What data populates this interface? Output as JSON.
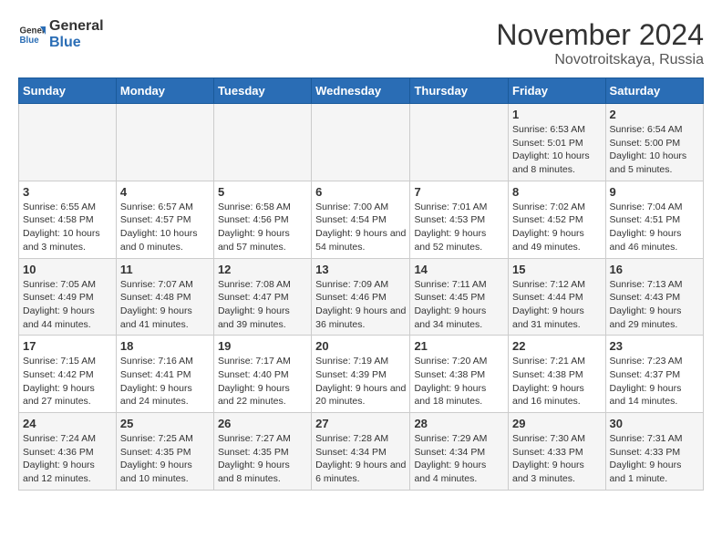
{
  "logo": {
    "text1": "General",
    "text2": "Blue"
  },
  "title": "November 2024",
  "subtitle": "Novotroitskaya, Russia",
  "weekdays": [
    "Sunday",
    "Monday",
    "Tuesday",
    "Wednesday",
    "Thursday",
    "Friday",
    "Saturday"
  ],
  "weeks": [
    [
      {
        "day": "",
        "info": ""
      },
      {
        "day": "",
        "info": ""
      },
      {
        "day": "",
        "info": ""
      },
      {
        "day": "",
        "info": ""
      },
      {
        "day": "",
        "info": ""
      },
      {
        "day": "1",
        "info": "Sunrise: 6:53 AM\nSunset: 5:01 PM\nDaylight: 10 hours and 8 minutes."
      },
      {
        "day": "2",
        "info": "Sunrise: 6:54 AM\nSunset: 5:00 PM\nDaylight: 10 hours and 5 minutes."
      }
    ],
    [
      {
        "day": "3",
        "info": "Sunrise: 6:55 AM\nSunset: 4:58 PM\nDaylight: 10 hours and 3 minutes."
      },
      {
        "day": "4",
        "info": "Sunrise: 6:57 AM\nSunset: 4:57 PM\nDaylight: 10 hours and 0 minutes."
      },
      {
        "day": "5",
        "info": "Sunrise: 6:58 AM\nSunset: 4:56 PM\nDaylight: 9 hours and 57 minutes."
      },
      {
        "day": "6",
        "info": "Sunrise: 7:00 AM\nSunset: 4:54 PM\nDaylight: 9 hours and 54 minutes."
      },
      {
        "day": "7",
        "info": "Sunrise: 7:01 AM\nSunset: 4:53 PM\nDaylight: 9 hours and 52 minutes."
      },
      {
        "day": "8",
        "info": "Sunrise: 7:02 AM\nSunset: 4:52 PM\nDaylight: 9 hours and 49 minutes."
      },
      {
        "day": "9",
        "info": "Sunrise: 7:04 AM\nSunset: 4:51 PM\nDaylight: 9 hours and 46 minutes."
      }
    ],
    [
      {
        "day": "10",
        "info": "Sunrise: 7:05 AM\nSunset: 4:49 PM\nDaylight: 9 hours and 44 minutes."
      },
      {
        "day": "11",
        "info": "Sunrise: 7:07 AM\nSunset: 4:48 PM\nDaylight: 9 hours and 41 minutes."
      },
      {
        "day": "12",
        "info": "Sunrise: 7:08 AM\nSunset: 4:47 PM\nDaylight: 9 hours and 39 minutes."
      },
      {
        "day": "13",
        "info": "Sunrise: 7:09 AM\nSunset: 4:46 PM\nDaylight: 9 hours and 36 minutes."
      },
      {
        "day": "14",
        "info": "Sunrise: 7:11 AM\nSunset: 4:45 PM\nDaylight: 9 hours and 34 minutes."
      },
      {
        "day": "15",
        "info": "Sunrise: 7:12 AM\nSunset: 4:44 PM\nDaylight: 9 hours and 31 minutes."
      },
      {
        "day": "16",
        "info": "Sunrise: 7:13 AM\nSunset: 4:43 PM\nDaylight: 9 hours and 29 minutes."
      }
    ],
    [
      {
        "day": "17",
        "info": "Sunrise: 7:15 AM\nSunset: 4:42 PM\nDaylight: 9 hours and 27 minutes."
      },
      {
        "day": "18",
        "info": "Sunrise: 7:16 AM\nSunset: 4:41 PM\nDaylight: 9 hours and 24 minutes."
      },
      {
        "day": "19",
        "info": "Sunrise: 7:17 AM\nSunset: 4:40 PM\nDaylight: 9 hours and 22 minutes."
      },
      {
        "day": "20",
        "info": "Sunrise: 7:19 AM\nSunset: 4:39 PM\nDaylight: 9 hours and 20 minutes."
      },
      {
        "day": "21",
        "info": "Sunrise: 7:20 AM\nSunset: 4:38 PM\nDaylight: 9 hours and 18 minutes."
      },
      {
        "day": "22",
        "info": "Sunrise: 7:21 AM\nSunset: 4:38 PM\nDaylight: 9 hours and 16 minutes."
      },
      {
        "day": "23",
        "info": "Sunrise: 7:23 AM\nSunset: 4:37 PM\nDaylight: 9 hours and 14 minutes."
      }
    ],
    [
      {
        "day": "24",
        "info": "Sunrise: 7:24 AM\nSunset: 4:36 PM\nDaylight: 9 hours and 12 minutes."
      },
      {
        "day": "25",
        "info": "Sunrise: 7:25 AM\nSunset: 4:35 PM\nDaylight: 9 hours and 10 minutes."
      },
      {
        "day": "26",
        "info": "Sunrise: 7:27 AM\nSunset: 4:35 PM\nDaylight: 9 hours and 8 minutes."
      },
      {
        "day": "27",
        "info": "Sunrise: 7:28 AM\nSunset: 4:34 PM\nDaylight: 9 hours and 6 minutes."
      },
      {
        "day": "28",
        "info": "Sunrise: 7:29 AM\nSunset: 4:34 PM\nDaylight: 9 hours and 4 minutes."
      },
      {
        "day": "29",
        "info": "Sunrise: 7:30 AM\nSunset: 4:33 PM\nDaylight: 9 hours and 3 minutes."
      },
      {
        "day": "30",
        "info": "Sunrise: 7:31 AM\nSunset: 4:33 PM\nDaylight: 9 hours and 1 minute."
      }
    ]
  ]
}
